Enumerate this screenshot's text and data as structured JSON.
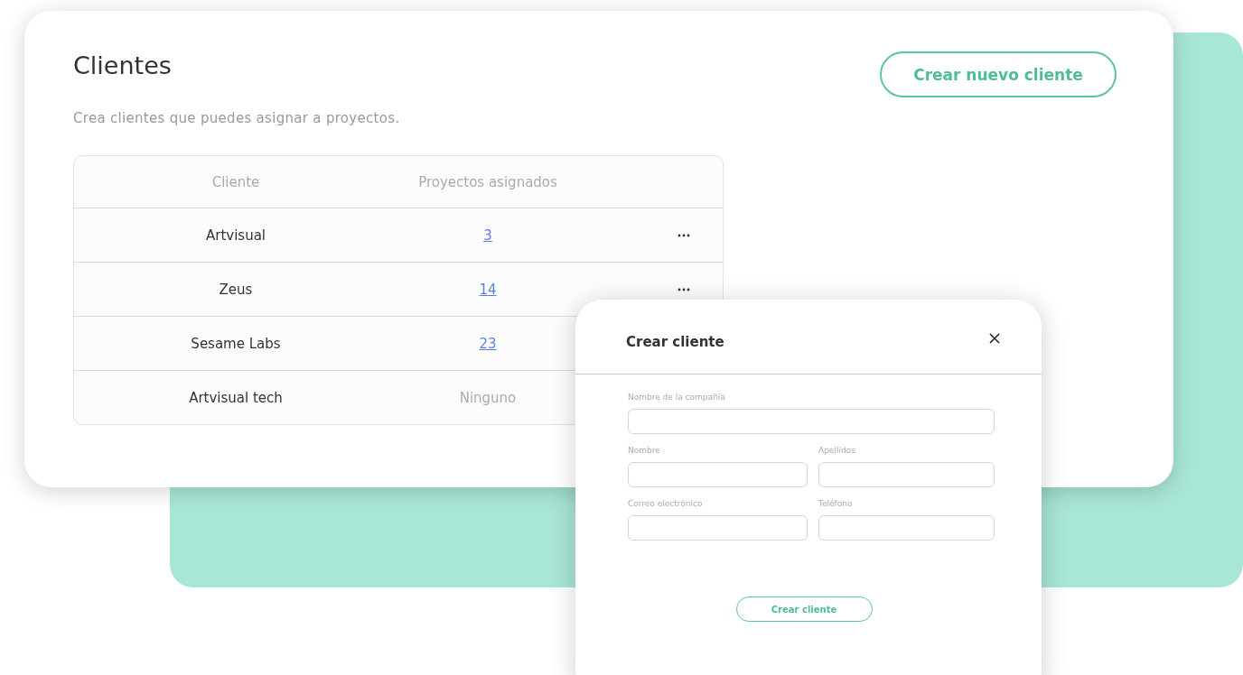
{
  "page": {
    "title": "Clientes",
    "subtitle": "Crea clientes que puedes asignar a proyectos.",
    "new_button": "Crear nuevo cliente"
  },
  "table": {
    "columns": [
      "Cliente",
      "Proyectos asignados"
    ],
    "rows": [
      {
        "client": "Artvisual",
        "projects": "3",
        "linked": true
      },
      {
        "client": "Zeus",
        "projects": "14",
        "linked": true
      },
      {
        "client": "Sesame Labs",
        "projects": "23",
        "linked": true
      },
      {
        "client": "Artvisual tech",
        "projects": "Ninguno",
        "linked": false
      }
    ]
  },
  "dialog": {
    "title": "Crear cliente",
    "company_field": {
      "label": "Nombre de la compañía"
    },
    "fields": [
      {
        "label": "Nombre"
      },
      {
        "label": "Apellidos"
      },
      {
        "label": "Correo electrónico"
      },
      {
        "label": "Teléfono"
      }
    ],
    "submit": "Crear cliente"
  }
}
